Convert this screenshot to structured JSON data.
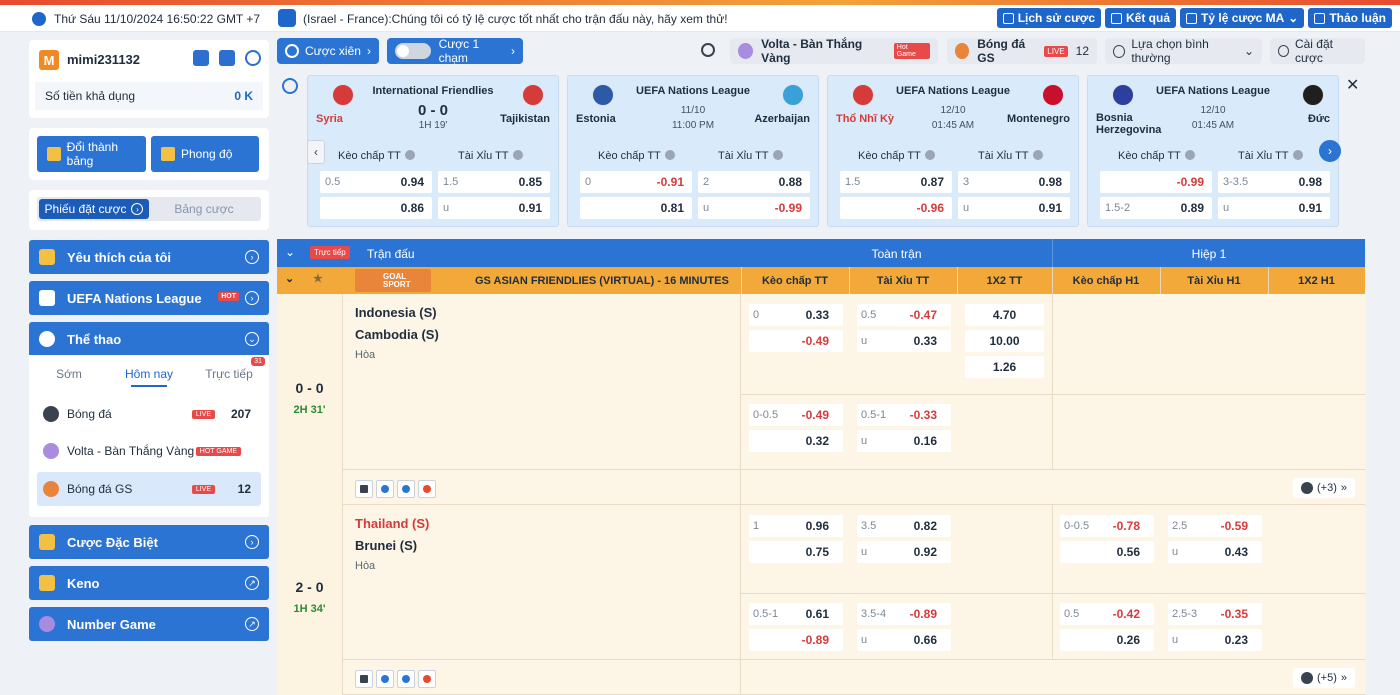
{
  "topbar": {
    "datetime": "Thứ Sáu 11/10/2024 16:50:22 GMT +7",
    "marquee": "(Israel - France):Chúng tôi có tỷ lệ cược tốt nhất cho trận đấu này, hãy xem thử!",
    "buttons": [
      "Lịch sử cược",
      "Kết quả",
      "Tỷ lệ cược MA",
      "Thảo luận"
    ]
  },
  "user": {
    "avatar_letter": "M",
    "name": "mimi231132",
    "balance_label": "Số tiền khả dụng",
    "balance_value": "0 K"
  },
  "actions": {
    "redeem": "Đổi thành bảng",
    "form": "Phong độ"
  },
  "bet_tabs": {
    "active": "Phiếu đặt cược",
    "other": "Bảng cược"
  },
  "nav": {
    "favorites": "Yêu thích của tôi",
    "uefa": "UEFA Nations League",
    "hot": "HOT",
    "sports": "Thể thao",
    "special": "Cược Đặc Biệt",
    "keno": "Keno",
    "number_game": "Number Game"
  },
  "sport_tabs": {
    "early": "Sớm",
    "today": "Hôm nay",
    "live": "Trực tiếp",
    "live_count": "31"
  },
  "sport_list": [
    {
      "label": "Bóng đá",
      "tag": "LIVE",
      "count": "207"
    },
    {
      "label": "Volta - Bàn Thắng Vàng",
      "tag": "HOT GAME",
      "count": ""
    },
    {
      "label": "Bóng đá GS",
      "tag": "LIVE",
      "count": "12"
    }
  ],
  "toolbar": {
    "parlay": "Cược xiên",
    "one_click": "Cược 1 chạm",
    "volta": "Volta - Bàn Thắng Vàng",
    "hot_game": "Hot Game",
    "gs": "Bóng đá GS",
    "live": "LIVE",
    "gs_count": "12",
    "select": "Lựa chọn bình thường",
    "settings": "Cài đặt cược"
  },
  "featured": [
    {
      "league": "International Friendlies",
      "home": "Syria",
      "away": "Tajikistan",
      "home_red": true,
      "score": "0 - 0",
      "time": "1H 19'",
      "date": "",
      "hdp": [
        [
          "0.5",
          "0.94",
          ""
        ],
        [
          "",
          "0.86",
          ""
        ]
      ],
      "ou": [
        [
          "1.5",
          "0.85",
          ""
        ],
        [
          "u",
          "0.91",
          ""
        ]
      ],
      "flags": [
        "#d63b3b",
        "#d63b3b"
      ]
    },
    {
      "league": "UEFA Nations League",
      "home": "Estonia",
      "away": "Azerbaijan",
      "home_red": false,
      "score": "",
      "time": "11:00 PM",
      "date": "11/10",
      "hdp": [
        [
          "0",
          "-0.91",
          "neg"
        ],
        [
          "",
          "0.81",
          ""
        ]
      ],
      "ou": [
        [
          "2",
          "0.88",
          ""
        ],
        [
          "u",
          "-0.99",
          "neg"
        ]
      ],
      "flags": [
        "#2d5aa8",
        "#3aa0d8"
      ]
    },
    {
      "league": "UEFA Nations League",
      "home": "Thổ Nhĩ Kỳ",
      "away": "Montenegro",
      "home_red": true,
      "score": "",
      "time": "01:45 AM",
      "date": "12/10",
      "hdp": [
        [
          "1.5",
          "0.87",
          ""
        ],
        [
          "",
          "-0.96",
          "neg"
        ]
      ],
      "ou": [
        [
          "3",
          "0.98",
          ""
        ],
        [
          "u",
          "0.91",
          ""
        ]
      ],
      "flags": [
        "#d63b3b",
        "#c8102e"
      ]
    },
    {
      "league": "UEFA Nations League",
      "home": "Bosnia Herzegovina",
      "away": "Đức",
      "home_red": false,
      "score": "",
      "time": "01:45 AM",
      "date": "12/10",
      "hdp": [
        [
          "",
          "-0.99",
          "neg"
        ],
        [
          "1.5-2",
          "0.89",
          ""
        ]
      ],
      "ou": [
        [
          "3-3.5",
          "0.98",
          ""
        ],
        [
          "u",
          "0.91",
          ""
        ]
      ],
      "flags": [
        "#2c3e9e",
        "#1f1f1f"
      ]
    }
  ],
  "featured_labels": {
    "hdp": "Kèo chấp TT",
    "ou": "Tài Xỉu TT"
  },
  "table": {
    "live": "Trực tiếp",
    "match": "Trận đấu",
    "full": "Toàn trận",
    "half": "Hiệp 1"
  },
  "league_row": {
    "name": "GS ASIAN FRIENDLIES (VIRTUAL) - 16 MINUTES",
    "logo": "GOAL SPORT",
    "cols": [
      "Kèo chấp TT",
      "Tài Xỉu TT",
      "1X2 TT",
      "Kèo chấp H1",
      "Tài Xỉu H1",
      "1X2 H1"
    ]
  },
  "matches": [
    {
      "score": "0 - 0",
      "time": "2H 31'",
      "home": "Indonesia (S)",
      "away": "Cambodia (S)",
      "home_red": false,
      "draw": "Hòa",
      "more": "(+3)",
      "rows": [
        {
          "hdp": [
            [
              "0",
              "0.33",
              ""
            ],
            [
              "",
              "-0.49",
              "neg"
            ]
          ],
          "ou": [
            [
              "0.5",
              "-0.47",
              "neg"
            ],
            [
              "u",
              "0.33",
              ""
            ]
          ],
          "x12": [
            "4.70",
            "10.00",
            "1.26"
          ],
          "h1hdp": [],
          "h1ou": []
        },
        {
          "hdp": [
            [
              "0-0.5",
              "-0.49",
              "neg"
            ],
            [
              "",
              "0.32",
              ""
            ]
          ],
          "ou": [
            [
              "0.5-1",
              "-0.33",
              "neg"
            ],
            [
              "u",
              "0.16",
              ""
            ]
          ],
          "x12": [],
          "h1hdp": [],
          "h1ou": []
        }
      ]
    },
    {
      "score": "2 - 0",
      "time": "1H 34'",
      "home": "Thailand (S)",
      "away": "Brunei (S)",
      "home_red": true,
      "draw": "Hòa",
      "more": "(+5)",
      "rows": [
        {
          "hdp": [
            [
              "1",
              "0.96",
              ""
            ],
            [
              "",
              "0.75",
              ""
            ]
          ],
          "ou": [
            [
              "3.5",
              "0.82",
              ""
            ],
            [
              "u",
              "0.92",
              ""
            ]
          ],
          "x12": [],
          "h1hdp": [
            [
              "0-0.5",
              "-0.78",
              "neg"
            ],
            [
              "",
              "0.56",
              ""
            ]
          ],
          "h1ou": [
            [
              "2.5",
              "-0.59",
              "neg"
            ],
            [
              "u",
              "0.43",
              ""
            ]
          ]
        },
        {
          "hdp": [
            [
              "0.5-1",
              "0.61",
              ""
            ],
            [
              "",
              "-0.89",
              "neg"
            ]
          ],
          "ou": [
            [
              "3.5-4",
              "-0.89",
              "neg"
            ],
            [
              "u",
              "0.66",
              ""
            ]
          ],
          "x12": [],
          "h1hdp": [
            [
              "0.5",
              "-0.42",
              "neg"
            ],
            [
              "",
              "0.26",
              ""
            ]
          ],
          "h1ou": [
            [
              "2.5-3",
              "-0.35",
              "neg"
            ],
            [
              "u",
              "0.23",
              ""
            ]
          ]
        }
      ]
    }
  ]
}
